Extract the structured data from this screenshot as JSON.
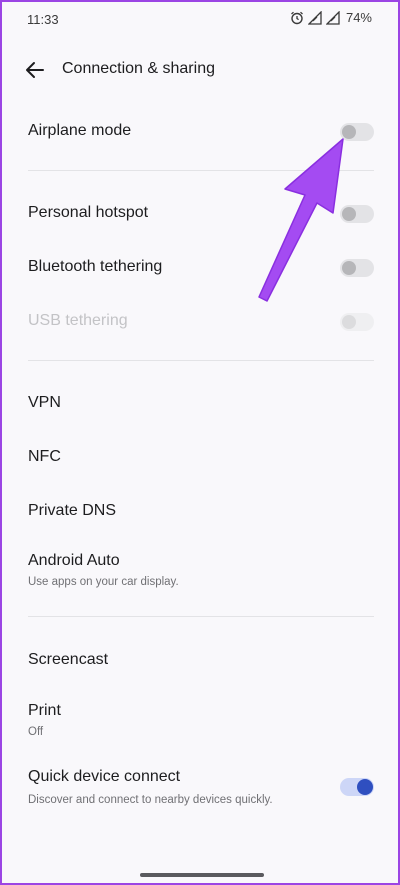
{
  "status_bar": {
    "time": "11:33",
    "battery": "74%",
    "icons": [
      "alarm-icon",
      "signal-icon",
      "signal-icon"
    ]
  },
  "header": {
    "title": "Connection & sharing",
    "back_icon": "arrow-left-icon"
  },
  "settings": {
    "airplane_mode": {
      "label": "Airplane mode",
      "enabled": false
    },
    "personal_hotspot": {
      "label": "Personal hotspot",
      "enabled": false
    },
    "bluetooth_tethering": {
      "label": "Bluetooth tethering",
      "enabled": false
    },
    "usb_tethering": {
      "label": "USB tethering",
      "enabled": false,
      "disabled": true
    },
    "vpn": {
      "label": "VPN"
    },
    "nfc": {
      "label": "NFC"
    },
    "private_dns": {
      "label": "Private DNS"
    },
    "android_auto": {
      "label": "Android Auto",
      "subtitle": "Use apps on your car display."
    },
    "screencast": {
      "label": "Screencast"
    },
    "print": {
      "label": "Print",
      "subtitle": "Off"
    },
    "quick_device_connect": {
      "label": "Quick device connect",
      "subtitle": "Discover and connect to nearby devices quickly.",
      "enabled": true
    }
  },
  "annotation": {
    "arrow_color": "#a44bf2",
    "icon": "arrow-pointer-icon"
  },
  "colors": {
    "border": "#9b45e4",
    "toggle_on": "#2f4fc0"
  }
}
